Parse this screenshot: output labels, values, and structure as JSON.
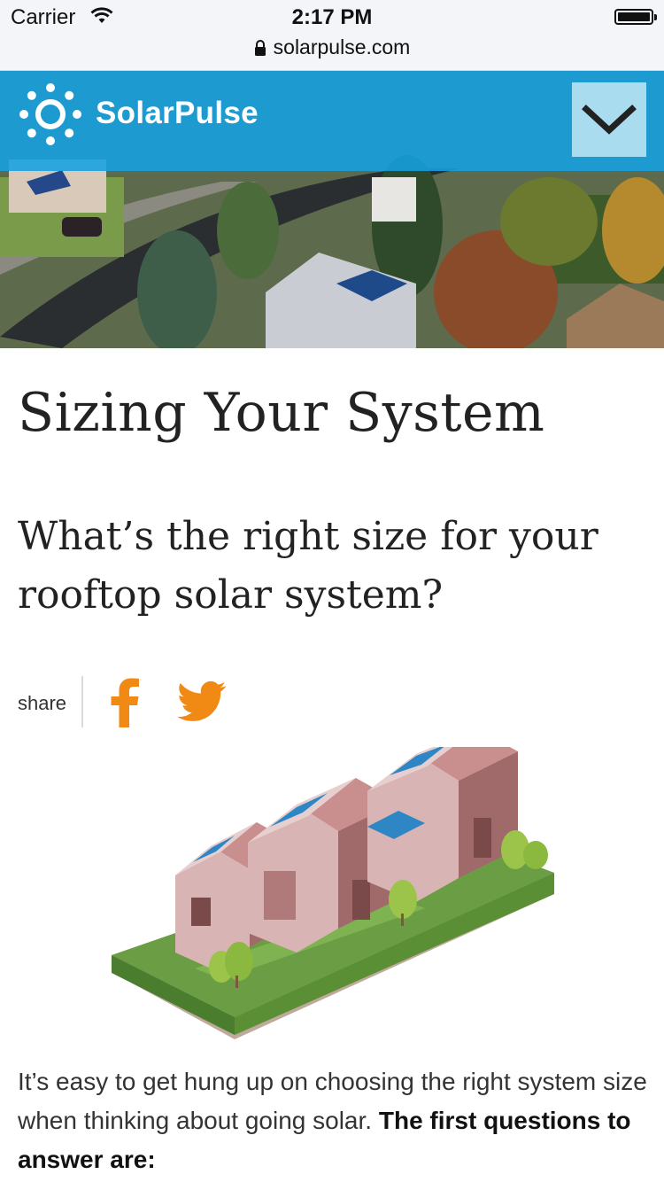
{
  "status_bar": {
    "carrier": "Carrier",
    "time": "2:17 PM",
    "url": "solarpulse.com"
  },
  "header": {
    "brand": "SolarPulse",
    "logo_icon": "sun-icon",
    "menu_icon": "chevron-down-icon",
    "accent_color": "#14a0e1"
  },
  "article": {
    "title": "Sizing Your System",
    "subtitle": "What’s the right size for your rooftop solar system?",
    "share_label": "share",
    "share_icons": [
      "facebook-icon",
      "twitter-icon"
    ],
    "share_color": "#f08a14",
    "body_intro": "It’s easy to get hung up on choosing the right system size when thinking about going solar.",
    "body_bold": "The first questions to answer are:"
  }
}
